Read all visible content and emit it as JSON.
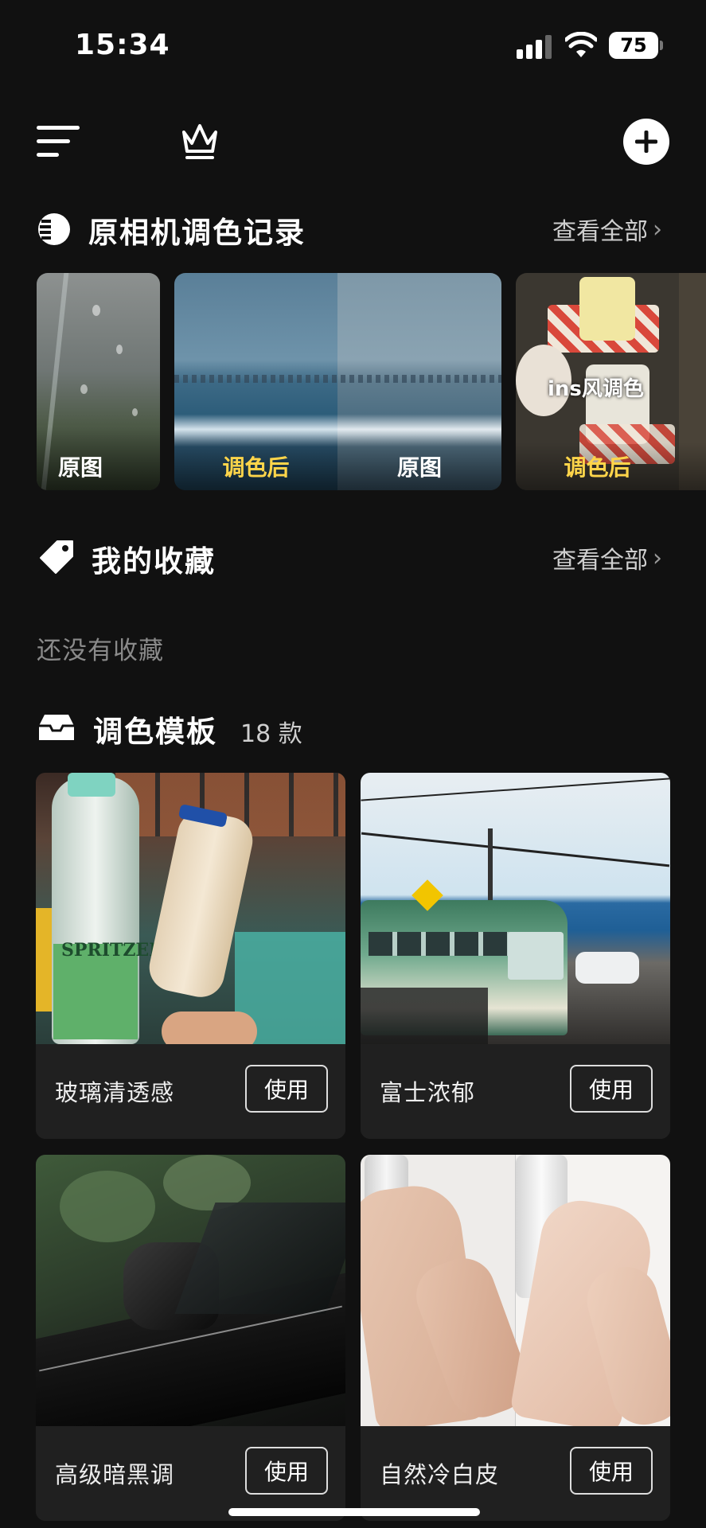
{
  "status_bar": {
    "time": "15:34",
    "battery": "75"
  },
  "toolbar": {
    "menu_icon": "menu-icon",
    "crown_icon": "crown-icon",
    "add_icon": "plus-icon"
  },
  "records": {
    "title": "原相机调色记录",
    "view_all": "查看全部",
    "cards": [
      {
        "caption": "原图"
      },
      {
        "caption_left": "调色后",
        "caption_right": "原图"
      },
      {
        "overlay": "ins风调色",
        "caption": "调色后"
      }
    ]
  },
  "favorites": {
    "title": "我的收藏",
    "view_all": "查看全部",
    "empty": "还没有收藏"
  },
  "templates": {
    "title": "调色模板",
    "count": "18 款",
    "use_label": "使用",
    "items": [
      {
        "name": "玻璃清透感"
      },
      {
        "name": "富士浓郁"
      },
      {
        "name": "高级暗黑调"
      },
      {
        "name": "自然冷白皮"
      }
    ]
  },
  "colors": {
    "background": "#111111",
    "accent_yellow": "#ffd54a",
    "card_bg": "#202020"
  }
}
